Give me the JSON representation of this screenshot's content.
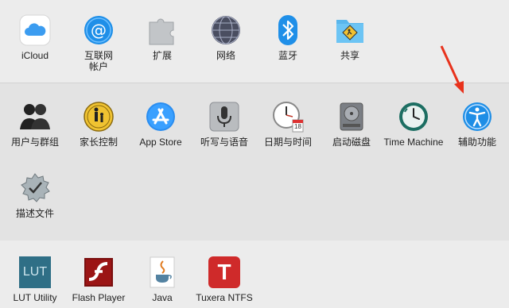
{
  "panes_top": [
    {
      "label": "iCloud",
      "icon": "icloud-icon"
    },
    {
      "label": "互联网\n帐户",
      "icon": "internet-accounts-icon"
    },
    {
      "label": "扩展",
      "icon": "extensions-icon"
    },
    {
      "label": "网络",
      "icon": "network-icon"
    },
    {
      "label": "蓝牙",
      "icon": "bluetooth-icon"
    },
    {
      "label": "共享",
      "icon": "sharing-icon"
    }
  ],
  "panes_system": [
    {
      "label": "用户与群组",
      "icon": "users-groups-icon"
    },
    {
      "label": "家长控制",
      "icon": "parental-controls-icon"
    },
    {
      "label": "App Store",
      "icon": "app-store-icon"
    },
    {
      "label": "听写与语音",
      "icon": "dictation-speech-icon"
    },
    {
      "label": "日期与时间",
      "icon": "date-time-icon"
    },
    {
      "label": "启动磁盘",
      "icon": "startup-disk-icon"
    },
    {
      "label": "Time Machine",
      "icon": "time-machine-icon"
    },
    {
      "label": "辅助功能",
      "icon": "accessibility-icon"
    },
    {
      "label": "描述文件",
      "icon": "profiles-icon"
    }
  ],
  "panes_other": [
    {
      "label": "LUT Utility",
      "icon": "lut-utility-icon",
      "icon_text": "LUT"
    },
    {
      "label": "Flash Player",
      "icon": "flash-player-icon"
    },
    {
      "label": "Java",
      "icon": "java-icon"
    },
    {
      "label": "Tuxera NTFS",
      "icon": "tuxera-ntfs-icon",
      "icon_text": "T"
    }
  ],
  "calendar_icon_day": "18",
  "colors": {
    "annotation_arrow": "#e8321c",
    "accent_blue": "#1e8ee6"
  }
}
